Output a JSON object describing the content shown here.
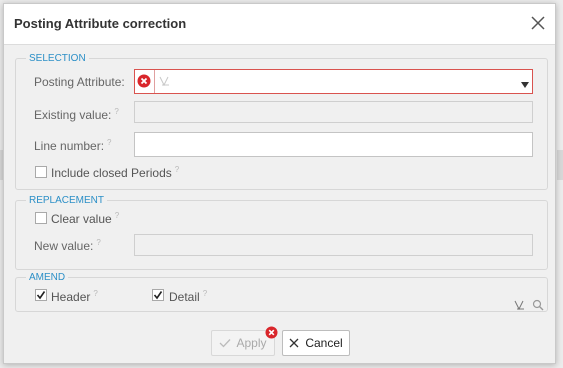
{
  "dialog": {
    "title": "Posting Attribute correction"
  },
  "selection": {
    "legend": "SELECTION",
    "posting_attribute_label": "Posting Attribute:",
    "posting_attribute_value": "",
    "existing_value_label": "Existing value:",
    "line_number_label": "Line number:",
    "include_closed_label": "Include closed Periods"
  },
  "replacement": {
    "legend": "REPLACEMENT",
    "clear_value_label": "Clear value",
    "new_value_label": "New value:"
  },
  "amend": {
    "legend": "AMEND",
    "header_label": "Header",
    "detail_label": "Detail"
  },
  "buttons": {
    "apply_label": "Apply",
    "cancel_label": "Cancel"
  },
  "help_mark": "?",
  "colors": {
    "accent": "#2b8fc7",
    "error": "#d9262b"
  }
}
